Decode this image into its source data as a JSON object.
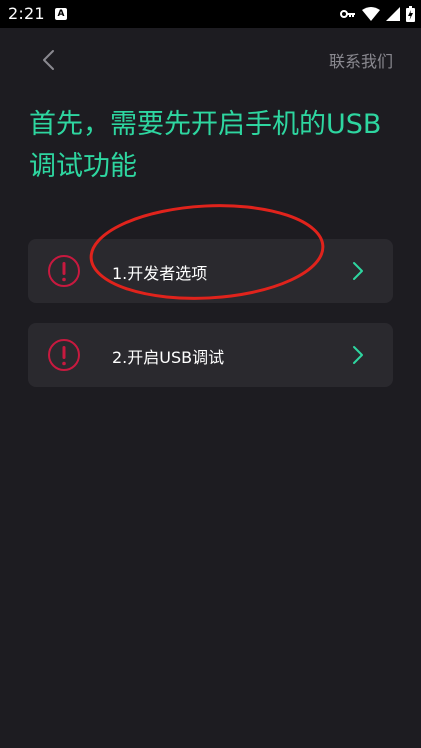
{
  "status_bar": {
    "time": "2:21",
    "notification_badge": "A",
    "icons": [
      "key-icon",
      "wifi-icon",
      "signal-icon",
      "battery-icon"
    ]
  },
  "header": {
    "back_icon": "chevron-left-icon",
    "contact_label": "联系我们"
  },
  "main": {
    "title": "首先，需要先开启手机的USB调试功能",
    "steps": [
      {
        "label": "1.开发者选项",
        "status_icon": "alert-icon",
        "action_icon": "chevron-right-icon"
      },
      {
        "label": "2.开启USB调试",
        "status_icon": "alert-icon",
        "action_icon": "chevron-right-icon"
      }
    ]
  },
  "colors": {
    "background": "#1d1c21",
    "card": "#2a292e",
    "accent": "#2ed6a0",
    "alert": "#c8193f",
    "annotation": "#e0231c",
    "muted_text": "#8a8990"
  }
}
